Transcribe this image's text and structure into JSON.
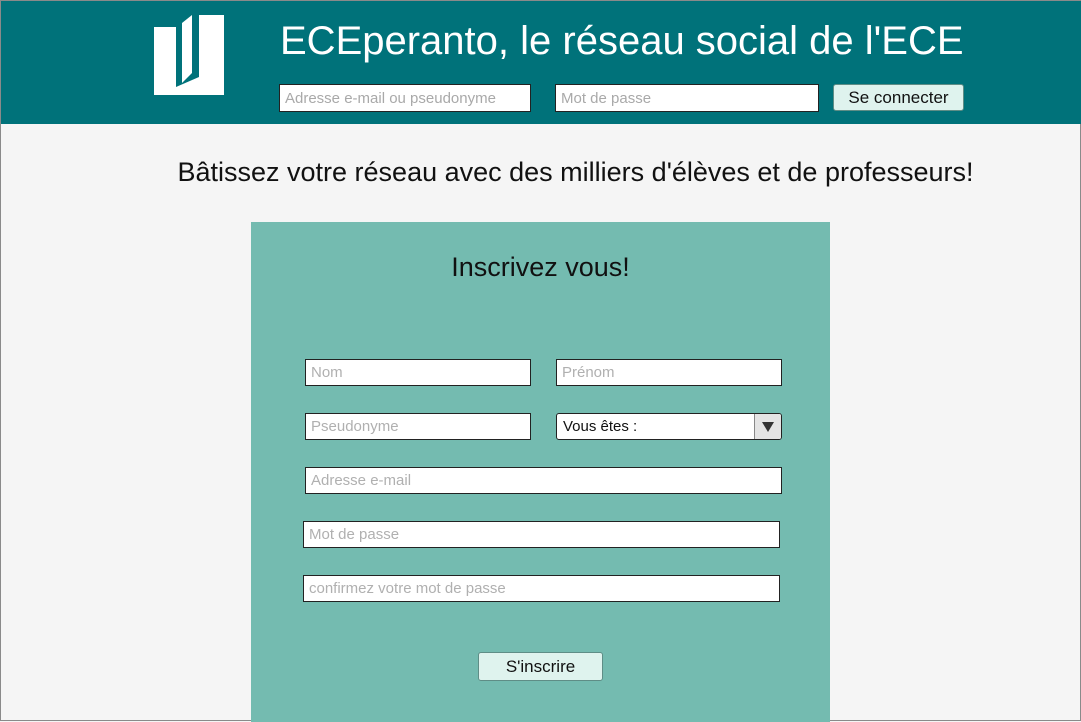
{
  "header": {
    "title": "ECEperanto, le réseau social de l'ECE",
    "login": {
      "identifier_placeholder": "Adresse e-mail ou pseudonyme",
      "password_placeholder": "Mot de passe",
      "submit_label": "Se connecter"
    }
  },
  "tagline": "Bâtissez votre réseau avec des milliers d'élèves et de professeurs!",
  "signup": {
    "title": "Inscrivez vous!",
    "last_name_placeholder": "Nom",
    "first_name_placeholder": "Prénom",
    "username_placeholder": "Pseudonyme",
    "role_select_value": "Vous êtes :",
    "email_placeholder": "Adresse e-mail",
    "password_placeholder": "Mot de passe",
    "confirm_password_placeholder": "confirmez votre mot de passe",
    "submit_label": "S'inscrire"
  },
  "colors": {
    "header_bg": "#00727a",
    "panel_bg": "#74bbb0",
    "button_bg": "#dff3ee",
    "page_bg": "#f5f5f5"
  },
  "icons": {
    "logo": "book-logo-icon",
    "select_arrow": "chevron-down-icon"
  }
}
